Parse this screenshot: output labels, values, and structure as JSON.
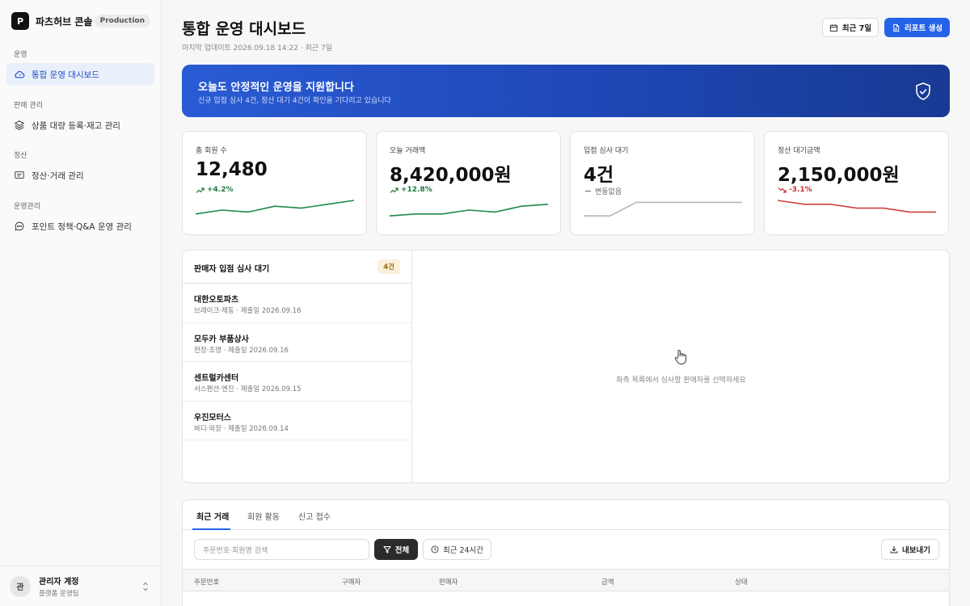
{
  "brand": {
    "logo_letter": "P",
    "name": "파츠허브 콘솔",
    "env": "Production"
  },
  "sidebar": {
    "sections": [
      {
        "title": "운영",
        "items": [
          {
            "label": "통합 운영 대시보드",
            "icon": "cloud-icon",
            "active": true
          }
        ]
      },
      {
        "title": "판매 관리",
        "items": [
          {
            "label": "상품 대량 등록·재고 관리",
            "icon": "layers-icon"
          }
        ]
      },
      {
        "title": "정산",
        "items": [
          {
            "label": "정산·거래 관리",
            "icon": "message-square-icon"
          }
        ]
      },
      {
        "title": "운영관리",
        "items": [
          {
            "label": "포인트 정책·Q&A 운영 관리",
            "icon": "chat-icon"
          }
        ]
      }
    ],
    "account": {
      "avatar": "관",
      "name": "관리자 계정",
      "role": "플랫폼 운영팀"
    }
  },
  "header": {
    "title": "통합 운영 대시보드",
    "subtitle": "마지막 업데이트 2026.09.18 14:22 · 최근 7일",
    "range_label": "최근 7일",
    "report_label": "리포트 생성"
  },
  "banner": {
    "title": "오늘도 안정적인 운영을 지원합니다",
    "subtitle": "신규 입점 심사 4건, 정산 대기 4건이 확인을 기다리고 있습니다"
  },
  "kpis": [
    {
      "label": "총 회원 수",
      "value": "12,480",
      "delta": "+4.2%",
      "trend": "up",
      "color": "#1f8a48",
      "spark": [
        3,
        5,
        4,
        7,
        6,
        8,
        10
      ]
    },
    {
      "label": "오늘 거래액",
      "value": "8,420,000원",
      "delta": "+12.8%",
      "trend": "up",
      "color": "#1f8a48",
      "spark": [
        2,
        3,
        3,
        5,
        4,
        7,
        8
      ]
    },
    {
      "label": "입점 심사 대기",
      "value": "4건",
      "delta": "변동없음",
      "trend": "flat",
      "color": "#b5b5b8",
      "spark": [
        2,
        2,
        9,
        9,
        9,
        9,
        9
      ]
    },
    {
      "label": "정산 대기금액",
      "value": "2,150,000원",
      "delta": "-3.1%",
      "trend": "down",
      "color": "#d04040",
      "spark": [
        10,
        8,
        8,
        6,
        6,
        4,
        4
      ]
    }
  ],
  "review": {
    "title": "판매자 입점 심사 대기",
    "count": "4건",
    "sellers": [
      {
        "name": "대한오토파츠",
        "meta": "브레이크·제동 · 제출일 2026.09.16"
      },
      {
        "name": "모두카 부품상사",
        "meta": "전장·조명 · 제출일 2026.09.16"
      },
      {
        "name": "센트럴카센터",
        "meta": "서스펜션·엔진 · 제출일 2026.09.15"
      },
      {
        "name": "우진모터스",
        "meta": "바디·외장 · 제출일 2026.09.14"
      }
    ],
    "empty_text": "좌측 목록에서 심사할 판매자를 선택하세요"
  },
  "transactions": {
    "tabs": [
      "최근 거래",
      "회원 활동",
      "신고 접수"
    ],
    "search_placeholder": "주문번호·회원명 검색",
    "filter_all": "전체",
    "filter_time": "최근 24시간",
    "export_label": "내보내기",
    "columns": [
      "주문번호",
      "구매자",
      "판매자",
      "금액",
      "상태"
    ]
  },
  "colors": {
    "accent": "#2463e8",
    "banner": "#1e47b5",
    "up": "#1f8a48",
    "down": "#d04040"
  }
}
